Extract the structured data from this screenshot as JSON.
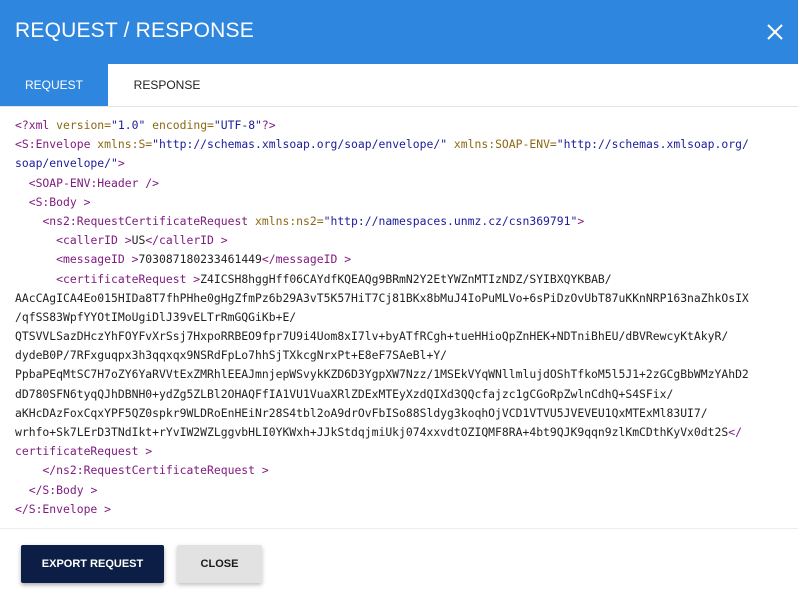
{
  "header": {
    "title": "REQUEST / RESPONSE",
    "close_icon": "close-icon"
  },
  "tabs": [
    {
      "label": "REQUEST",
      "active": true
    },
    {
      "label": "RESPONSE",
      "active": false
    }
  ],
  "xml": {
    "line1_decl_open": "<?xml ",
    "line1_attr1": "version=",
    "line1_val1": "\"1.0\"",
    "line1_attr2": " encoding=",
    "line1_val2": "\"UTF-8\"",
    "line1_decl_close": "?>",
    "line2_tag": "<S:Envelope ",
    "line2_attr1": "xmlns:S=",
    "line2_val1": "\"http://schemas.xmlsoap.org/soap/envelope/\"",
    "line2_attr2": " xmlns:SOAP-ENV=",
    "line2_val2a": "\"http://schemas.xmlsoap.org/",
    "line3_val2b": "soap/envelope/\"",
    "line3_tag": ">",
    "header_tag": "<SOAP-ENV:Header />",
    "body_open": "<S:Body >",
    "ns2_tag": "<ns2:RequestCertificateRequest ",
    "ns2_attr": "xmlns:ns2=",
    "ns2_val": "\"http://namespaces.unmz.cz/csn369791\"",
    "ns2_close": ">",
    "caller_open": "<callerID >",
    "caller_value": "US",
    "caller_close": "</callerID >",
    "message_open": "<messageID >",
    "message_value": "703087180233461449",
    "message_close": "</messageID >",
    "cert_open": "<certificateRequest >",
    "cert_line1": "Z4ICSH8hggHff06CAYdfKQEAQg9BRmN2Y2EtYWZnMTIzNDZ/SYIBXQYKBAB/",
    "cert_line2": "AAcCAgICA4Eo015HIDa8T7fhPHhe0gHgZfmPz6b29A3vT5K57HiT7Cj81BKx8bMuJ4IoPuMLVo+6sPiDzOvUbT87uKKnNRP163naZhkOsIX",
    "cert_line3": "/qfSS83WpfYYOtIMoUgiDlJ39vELTrRmGQGiKb+E/",
    "cert_line4": "QTSVVLSazDHczYhFOYFvXrSsj7HxpoRRBEO9fpr7U9i4Uom8xI7lv+byATfRCgh+tueHHioQpZnHEK+NDTniBhEU/dBVRewcyKtAkyR/",
    "cert_line5": "dydeB0P/7RFxguqpx3h3qqxqx9NSRdFpLo7hhSjTXkcgNrxPt+E8eF7SAeBl+Y/",
    "cert_line6": "PpbaPEqMtSC7H7oZY6YaRVVtExZMRhlEEAJmnjepWSvykKZD6D3YgpXW7Nzz/1MSEkVYqWNllmlujdOShTfkoM5l5J1+2zGCgBbWMzYAhD2",
    "cert_line7": "dD780SFN6tyqQJhDBNH0+ydZg5ZLBl2OHAQFfIA1VU1VuaXRlZDExMTEyXzdQIXd3QQcfajzc1gCGoRpZwlnCdhQ+S4SFix/",
    "cert_line8": "aKHcDAzFoxCqxYPF5QZ0spkr9WLDRoEnHEiNr28S4tbl2oA9drOvFbISo88Sldyg3koqhOjVCD1VTVU5JVEVEU1QxMTExMl83UI7/",
    "cert_line9": "wrhfo+Sk7LErD3TNdIkt+rYvIW2WZLggvbHLI0YKWxh+JJkStdqjmiUkj074xxvdtOZIQMF8RA+4bt9QJK9qqn9zlKmCDthKyVx0dt2S",
    "cert_close_a": "</",
    "cert_close_b": "certificateRequest >",
    "ns2_end": "</ns2:RequestCertificateRequest >",
    "body_close": "</S:Body >",
    "envelope_close": "</S:Envelope >"
  },
  "footer": {
    "export_label": "EXPORT REQUEST",
    "close_label": "CLOSE"
  }
}
